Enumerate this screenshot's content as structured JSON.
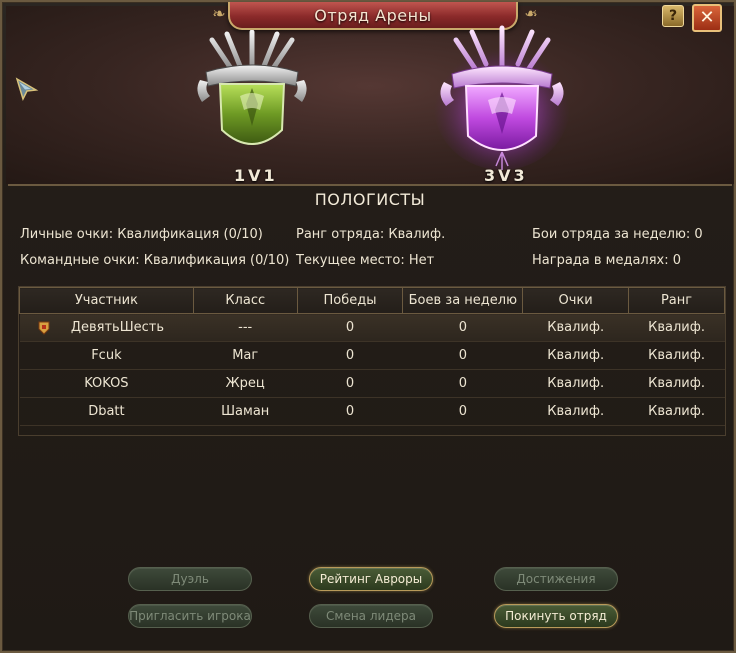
{
  "window": {
    "title": "Отряд Арены",
    "help_label": "?",
    "close_label": "✕"
  },
  "modes": {
    "solo_label": "1V1",
    "team_label": "3V3"
  },
  "squad": {
    "name": "ПОЛОГИСТЫ"
  },
  "stats": {
    "personal_points": "Личные очки: Квалификация (0/10)",
    "team_points": "Командные очки: Квалификация (0/10)",
    "squad_rank": "Ранг отряда: Квалиф.",
    "current_place": "Текущее место: Нет",
    "weekly_battles": "Бои отряда за неделю:  0",
    "medal_reward": "Награда в медалях:  0"
  },
  "table": {
    "headers": [
      "Участник",
      "Класс",
      "Победы",
      "Боев за неделю",
      "Очки",
      "Ранг"
    ],
    "rows": [
      [
        "ДевятьШесть",
        "---",
        "0",
        "0",
        "Квалиф.",
        "Квалиф."
      ],
      [
        "Fcuk",
        "Маг",
        "0",
        "0",
        "Квалиф.",
        "Квалиф."
      ],
      [
        "KOKOS",
        "Жрец",
        "0",
        "0",
        "Квалиф.",
        "Квалиф."
      ],
      [
        "Dbatt",
        "Шаман",
        "0",
        "0",
        "Квалиф.",
        "Квалиф."
      ]
    ]
  },
  "buttons": {
    "duel": "Дуэль",
    "aurora_rating": "Рейтинг Авроры",
    "achievements": "Достижения",
    "invite_player": "Пригласить игрока",
    "change_leader": "Смена лидера",
    "leave_squad": "Покинуть отряд"
  },
  "colors": {
    "solo_emblem": "#8fc23a",
    "team_emblem": "#c84ae8",
    "title_plate": "#8b2a2a",
    "frame_gold": "#c9a96b"
  },
  "icons": {
    "leader": "leader-crest-icon",
    "cursor": "pointer-cursor-icon"
  }
}
